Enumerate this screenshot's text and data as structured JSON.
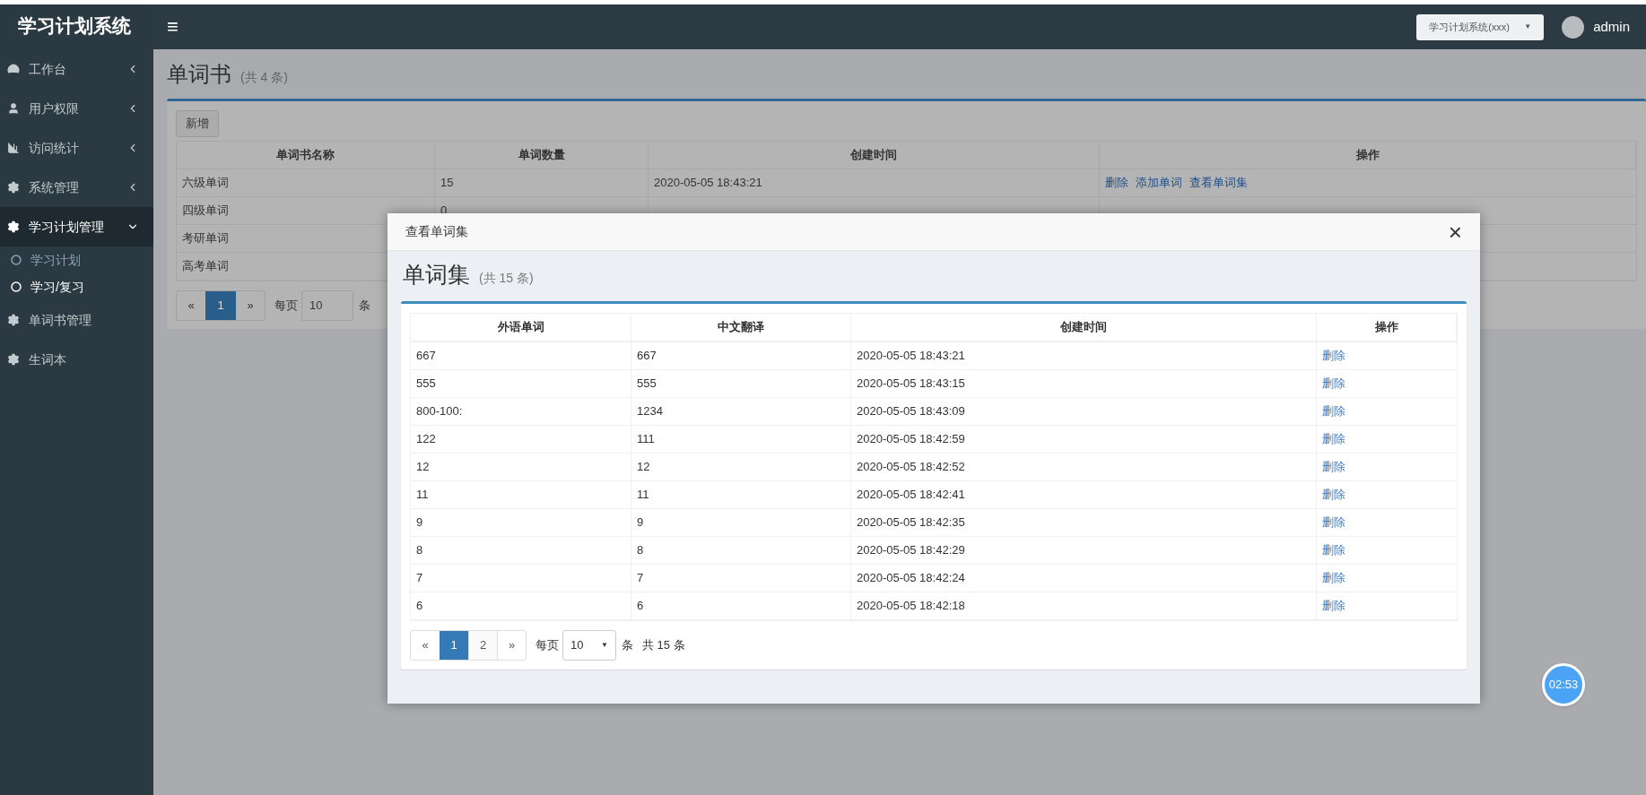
{
  "header": {
    "brand": "学习计划系统",
    "menu_toggle": "≡",
    "system_select": {
      "value": "学习计划系统(xxx)",
      "caret": "▼"
    },
    "user": "admin"
  },
  "sidebar": {
    "items": [
      {
        "kind": "dashboard",
        "label": "工作台",
        "expanded": false
      },
      {
        "kind": "user",
        "label": "用户权限",
        "expanded": false
      },
      {
        "kind": "chart",
        "label": "访问统计",
        "expanded": false
      },
      {
        "kind": "gear",
        "label": "系统管理",
        "expanded": false
      },
      {
        "kind": "gear",
        "label": "学习计划管理",
        "expanded": true,
        "children": [
          {
            "label": "学习计划",
            "selected": false
          },
          {
            "label": "学习/复习",
            "selected": true
          }
        ]
      },
      {
        "kind": "gear",
        "label": "单词书管理"
      },
      {
        "kind": "gear",
        "label": "生词本"
      }
    ]
  },
  "page": {
    "title": "单词书",
    "count": "(共 4 条)",
    "add_button": "新增",
    "table": {
      "columns": [
        "单词书名称",
        "单词数量",
        "创建时间",
        "操作"
      ],
      "rows": [
        {
          "cells": [
            "六级单词",
            "15",
            "2020-05-05 18:43:21"
          ],
          "actions": [
            "删除",
            "添加单词",
            "查看单词集"
          ]
        },
        {
          "cells": [
            "四级单词",
            "0"
          ]
        },
        {
          "cells": [
            "考研单词"
          ]
        },
        {
          "cells": [
            "高考单词"
          ]
        }
      ]
    },
    "pagination": {
      "prev": "«",
      "pages": [
        {
          "label": "1",
          "selected": true
        }
      ],
      "next": "»",
      "per_page_label": "每页",
      "per_page": "10",
      "unit": "条"
    }
  },
  "modal": {
    "title": "查看单词集",
    "close": "×",
    "heading": "单词集",
    "count": "(共 15 条)",
    "table": {
      "columns": [
        "外语单词",
        "中文翻译",
        "创建时间",
        "操作"
      ],
      "rows": [
        {
          "cells": [
            "667",
            "667",
            "2020-05-05 18:43:21"
          ],
          "action": "删除"
        },
        {
          "cells": [
            "555",
            "555",
            "2020-05-05 18:43:15"
          ],
          "action": "删除"
        },
        {
          "cells": [
            "800-100:",
            "1234",
            "2020-05-05 18:43:09"
          ],
          "action": "删除"
        },
        {
          "cells": [
            "122",
            "111",
            "2020-05-05 18:42:59"
          ],
          "action": "删除"
        },
        {
          "cells": [
            "12",
            "12",
            "2020-05-05 18:42:52"
          ],
          "action": "删除"
        },
        {
          "cells": [
            "11",
            "11",
            "2020-05-05 18:42:41"
          ],
          "action": "删除"
        },
        {
          "cells": [
            "9",
            "9",
            "2020-05-05 18:42:35"
          ],
          "action": "删除"
        },
        {
          "cells": [
            "8",
            "8",
            "2020-05-05 18:42:29"
          ],
          "action": "删除"
        },
        {
          "cells": [
            "7",
            "7",
            "2020-05-05 18:42:24"
          ],
          "action": "删除"
        },
        {
          "cells": [
            "6",
            "6",
            "2020-05-05 18:42:18"
          ],
          "action": "删除"
        }
      ]
    },
    "pagination": {
      "prev": "«",
      "pages": [
        {
          "label": "1",
          "selected": true
        },
        {
          "label": "2",
          "selected": false
        }
      ],
      "next": "»",
      "per_page_label": "每页",
      "per_page": "10",
      "caret": "▼",
      "unit": "条",
      "total": "共 15 条"
    }
  },
  "timer": "02:53"
}
